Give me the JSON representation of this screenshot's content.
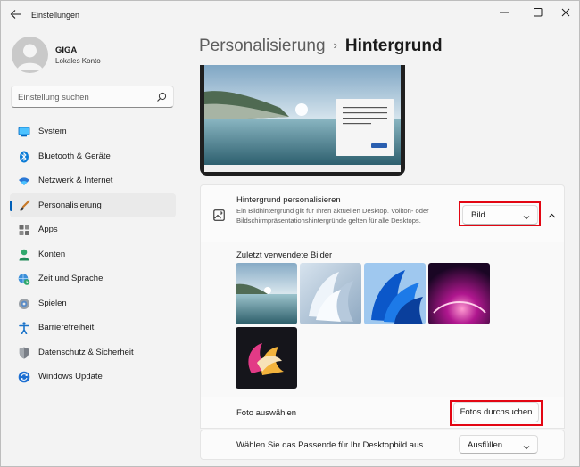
{
  "window": {
    "title": "Einstellungen"
  },
  "profile": {
    "name": "GIGA",
    "account_type": "Lokales Konto"
  },
  "search": {
    "placeholder": "Einstellung suchen",
    "icon": "search-icon"
  },
  "sidebar": {
    "items": [
      {
        "label": "System",
        "icon": "monitor-icon",
        "active": false
      },
      {
        "label": "Bluetooth & Geräte",
        "icon": "bluetooth-icon",
        "active": false
      },
      {
        "label": "Netzwerk & Internet",
        "icon": "wifi-icon",
        "active": false
      },
      {
        "label": "Personalisierung",
        "icon": "brush-icon",
        "active": true
      },
      {
        "label": "Apps",
        "icon": "apps-icon",
        "active": false
      },
      {
        "label": "Konten",
        "icon": "person-icon",
        "active": false
      },
      {
        "label": "Zeit und Sprache",
        "icon": "globe-clock-icon",
        "active": false
      },
      {
        "label": "Spielen",
        "icon": "gamepad-icon",
        "active": false
      },
      {
        "label": "Barrierefreiheit",
        "icon": "accessibility-icon",
        "active": false
      },
      {
        "label": "Datenschutz & Sicherheit",
        "icon": "shield-icon",
        "active": false
      },
      {
        "label": "Windows Update",
        "icon": "update-icon",
        "active": false
      }
    ]
  },
  "breadcrumb": {
    "parent": "Personalisierung",
    "separator": "›",
    "current": "Hintergrund"
  },
  "background_section": {
    "title": "Hintergrund personalisieren",
    "description": "Ein Bildhintergrund gilt für Ihren aktuellen Desktop. Vollton- oder Bildschirmpräsentationshintergründe gelten für alle Desktops.",
    "type_value": "Bild",
    "expanded": true
  },
  "recent_images": {
    "label": "Zuletzt verwendete Bilder",
    "images": [
      "lake-landscape",
      "white-bloom",
      "blue-bloom",
      "purple-glow",
      "pink-gold-shape"
    ]
  },
  "choose_photo": {
    "label": "Foto auswählen",
    "button_label": "Fotos durchsuchen"
  },
  "fit": {
    "label": "Wählen Sie das Passende für Ihr Desktopbild aus.",
    "value": "Ausfüllen"
  },
  "colors": {
    "accent": "#005fb8",
    "highlight": "#e30613"
  }
}
